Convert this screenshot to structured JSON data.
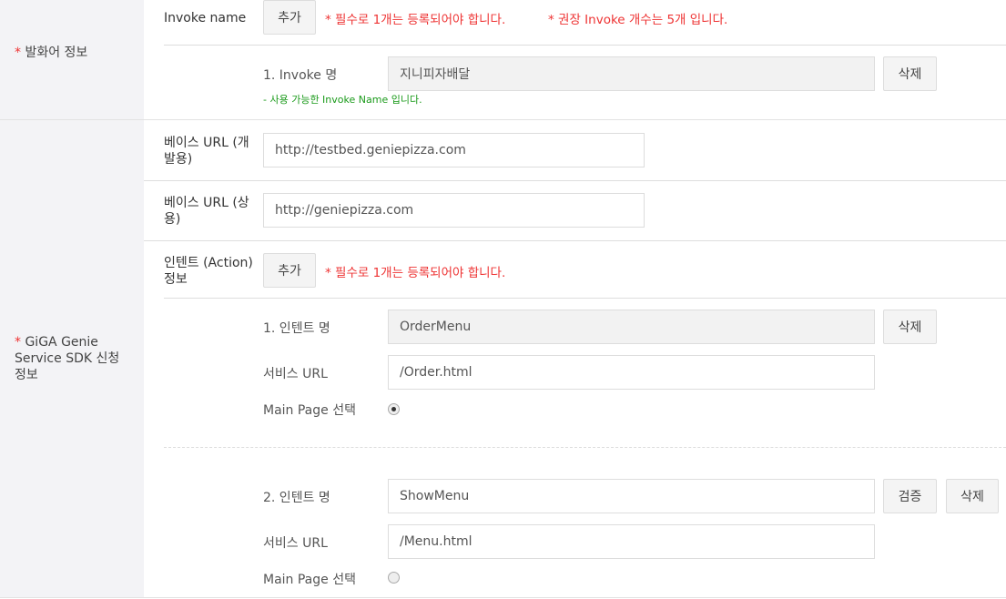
{
  "section1": {
    "label": "발화어 정보",
    "required_mark": "*",
    "invoke_label": "Invoke name",
    "add_button": "추가",
    "warning1": "* 필수로 1개는 등록되어야 합니다.",
    "warning2": "* 권장 Invoke 개수는 5개 입니다.",
    "item_label": "1. Invoke 명",
    "item_value": "지니피자배달",
    "delete_button": "삭제",
    "status": "- 사용 가능한 Invoke Name 입니다."
  },
  "section2": {
    "label": "GiGA Genie Service SDK 신청 정보",
    "required_mark": "*",
    "base_url_dev_label": "베이스 URL (개발용)",
    "base_url_dev_value": "http://testbed.geniepizza.com",
    "base_url_prod_label": "베이스 URL (상용)",
    "base_url_prod_value": "http://geniepizza.com",
    "intent_label": "인텐트 (Action) 정보",
    "add_button": "추가",
    "intent_warning": "* 필수로 1개는 등록되어야 합니다.",
    "intents": [
      {
        "name_label": "1. 인텐트 명",
        "name_value": "OrderMenu",
        "url_label": "서비스 URL",
        "url_value": "/Order.html",
        "main_label": "Main Page 선택",
        "main_selected": true,
        "delete_button": "삭제"
      },
      {
        "name_label": "2. 인텐트 명",
        "name_value": "ShowMenu",
        "url_label": "서비스 URL",
        "url_value": "/Menu.html",
        "main_label": "Main Page 선택",
        "main_selected": false,
        "verify_button": "검증",
        "delete_button": "삭제"
      }
    ]
  }
}
